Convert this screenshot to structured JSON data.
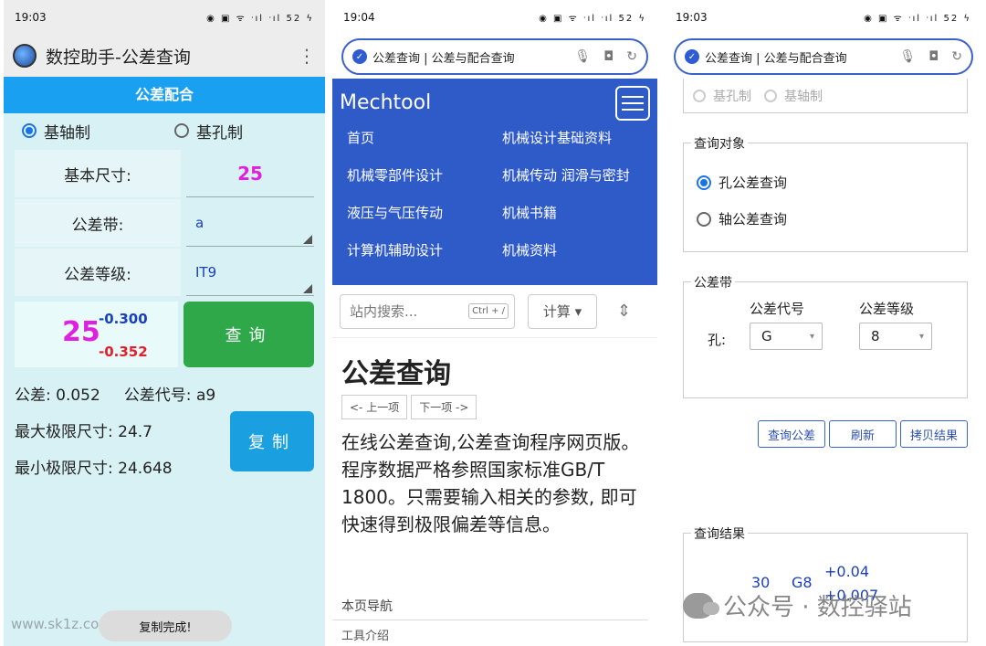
{
  "p1": {
    "time": "19:03",
    "status_icons": "◉ ▣ ᯤ ᐧıl ᐧıl 52 ϟ",
    "title": "数控助手-公差查询",
    "menu": "⋮",
    "section": "公差配合",
    "radio_shaft": "基轴制",
    "radio_hole": "基孔制",
    "label_basic": "基本尺寸:",
    "basic_value": "25",
    "label_band": "公差带:",
    "band_value": "a",
    "label_grade": "公差等级:",
    "grade_value": "IT9",
    "res_base": "25",
    "res_upper": "-0.300",
    "res_lower": "-0.352",
    "query_btn": "查询",
    "tolerance": "公差: 0.052",
    "code": "公差代号: a9",
    "max_limit": "最大极限尺寸: 24.7",
    "min_limit": "最小极限尺寸: 24.648",
    "copy_btn": "复制",
    "toast": "复制完成!",
    "watermark": "www.sk1z.com"
  },
  "p2": {
    "time": "19:04",
    "status_icons": "◉ ▣ ᯤ ᐧıl ᐧıl 52 ϟ",
    "url": "公差查询 | 公差与配合查询",
    "brand": "Mechtool",
    "nav": [
      "首页",
      "机械设计基础资料",
      "机械零部件设计",
      "机械传动 润滑与密封",
      "液压与气压传动",
      "机械书籍",
      "计算机辅助设计",
      "机械资料"
    ],
    "search_placeholder": "站内搜索...",
    "search_kbd": "Ctrl + /",
    "calc": "计算 ▾",
    "title": "公差查询",
    "prev": "<- 上一项",
    "next": "下一项 ->",
    "intro": "在线公差查询,公差查询程序网页版。程序数据严格参照国家标准GB/T 1800。只需要输入相关的参数, 即可快速得到极限偏差等信息。",
    "nav_heading": "本页导航",
    "tool_intro": "工具介绍"
  },
  "p3": {
    "time": "19:03",
    "status_icons": "◉ ▣ ᯤ ᐧıl ᐧıl 52 ϟ",
    "url": "公差查询 | 公差与配合查询",
    "sys_hole": "基孔制",
    "sys_shaft": "基轴制",
    "query_obj": "查询对象",
    "hole_query": "孔公差查询",
    "shaft_query": "轴公差查询",
    "band_legend": "公差带",
    "code_col": "公差代号",
    "grade_col": "公差等级",
    "row_label": "孔:",
    "code_val": "G",
    "grade_val": "8",
    "btn_query": "查询公差",
    "btn_refresh": "刷新",
    "btn_copy": "拷贝结果",
    "result_legend": "查询结果",
    "res_size": "30",
    "res_code": "G8",
    "res_upper": "+0.04",
    "res_lower": "+0.007"
  },
  "watermark": "公众号 · 数控驿站"
}
